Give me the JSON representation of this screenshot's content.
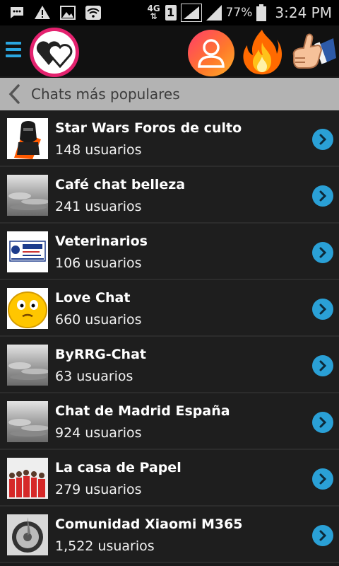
{
  "status_bar": {
    "network": "4G",
    "sim": "1",
    "battery": "77%",
    "time": "3:24 PM",
    "icons": [
      "message-icon",
      "warning-icon",
      "image-icon",
      "wifi-icon",
      "signal-icon",
      "battery-icon"
    ]
  },
  "app_bar": {
    "icons": [
      "menu-icon",
      "hearts-logo-icon",
      "profile-icon",
      "fire-icon",
      "thumbs-up-icon"
    ],
    "accent": "#2a9fd8",
    "logo_color": "#e4226f"
  },
  "header": {
    "back_icon": "chevron-left-icon",
    "title": "Chats más populares"
  },
  "chats": [
    {
      "name": "Star Wars Foros de culto",
      "users": "148 usuarios",
      "thumb": "vader"
    },
    {
      "name": "Café chat belleza",
      "users": "241 usuarios",
      "thumb": "clouds"
    },
    {
      "name": "Veterinarios",
      "users": "106 usuarios",
      "thumb": "card"
    },
    {
      "name": "Love Chat",
      "users": "660 usuarios",
      "thumb": "smiley"
    },
    {
      "name": "ByRRG-Chat",
      "users": "63 usuarios",
      "thumb": "clouds"
    },
    {
      "name": "Chat de Madrid España",
      "users": "924 usuarios",
      "thumb": "clouds"
    },
    {
      "name": "La casa de Papel",
      "users": "279 usuarios",
      "thumb": "redsuits"
    },
    {
      "name": "Comunidad Xiaomi M365",
      "users": "1,522 usuarios",
      "thumb": "wheel"
    }
  ]
}
